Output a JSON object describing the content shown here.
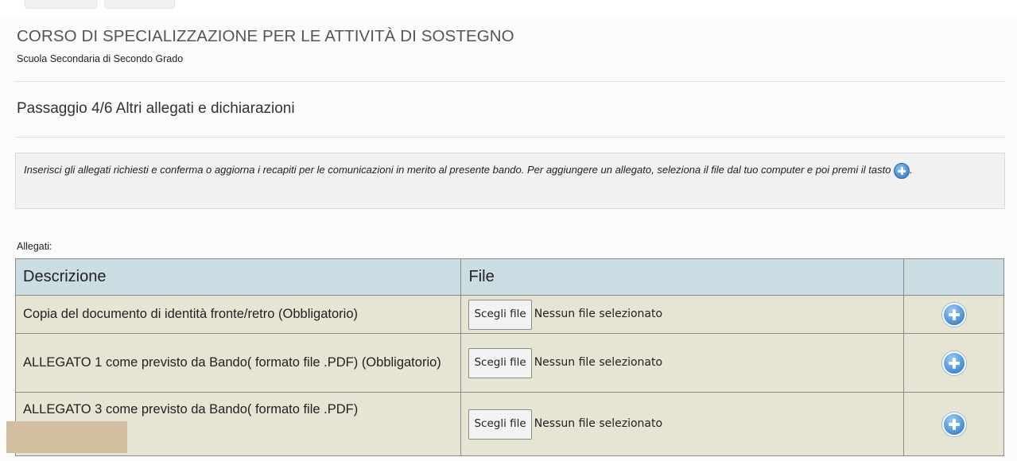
{
  "header": {
    "title": "CORSO DI SPECIALIZZAZIONE PER LE ATTIVITÀ DI SOSTEGNO",
    "subtitle": "Scuola Secondaria di Secondo Grado"
  },
  "step": {
    "title": "Passaggio 4/6 Altri allegati e dichiarazioni"
  },
  "info": {
    "text_before": "Inserisci gli allegati richiesti e conferma o aggiorna i recapiti per le comunicazioni in merito al presente bando. Per aggiungere un allegato, seleziona il file dal tuo computer e poi premi il tasto",
    "text_after": ".",
    "icon": "plus-circle-icon"
  },
  "attachments": {
    "label": "Allegati:",
    "columns": {
      "description": "Descrizione",
      "file": "File",
      "action": ""
    },
    "rows": [
      {
        "description": "Copia del documento di identità fronte/retro (Obbligatorio)",
        "choose_label": "Scegli file",
        "status": "Nessun file selezionato"
      },
      {
        "description": "ALLEGATO 1 come previsto da Bando( formato file .PDF) (Obbligatorio)",
        "choose_label": "Scegli file",
        "status": "Nessun file selezionato"
      },
      {
        "description": "ALLEGATO 3 come previsto da Bando( formato file .PDF)",
        "choose_label": "Scegli file",
        "status": "Nessun file selezionato"
      }
    ]
  },
  "colors": {
    "table_header_bg": "#c9dde3",
    "table_row_bg": "#e6e4d3",
    "accent_blue": "#4f96dd"
  }
}
